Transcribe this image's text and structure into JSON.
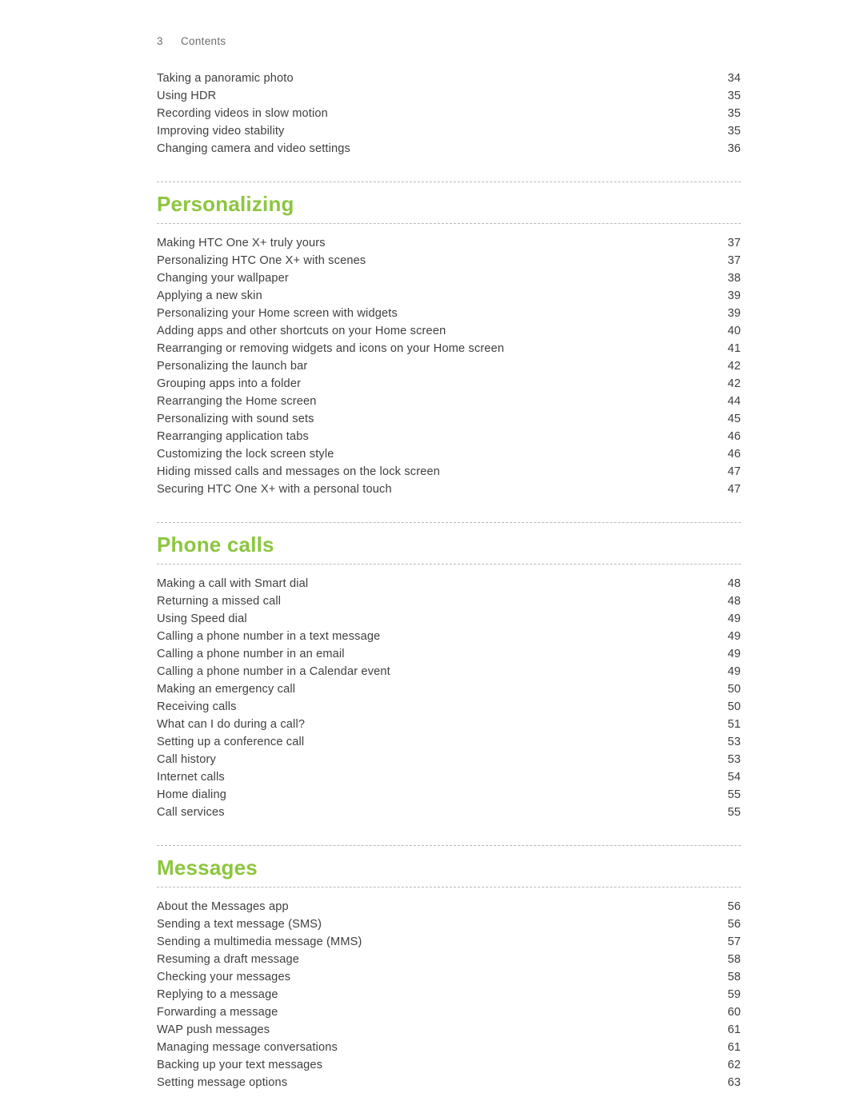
{
  "header": {
    "page_number": "3",
    "label": "Contents"
  },
  "top_entries": [
    {
      "title": "Taking a panoramic photo",
      "page": "34"
    },
    {
      "title": "Using HDR",
      "page": "35"
    },
    {
      "title": "Recording videos in slow motion",
      "page": "35"
    },
    {
      "title": "Improving video stability",
      "page": "35"
    },
    {
      "title": "Changing camera and video settings",
      "page": "36"
    }
  ],
  "sections": [
    {
      "title": "Personalizing",
      "entries": [
        {
          "title": "Making HTC One X+ truly yours",
          "page": "37"
        },
        {
          "title": "Personalizing HTC One X+ with scenes",
          "page": "37"
        },
        {
          "title": "Changing your wallpaper",
          "page": "38"
        },
        {
          "title": "Applying a new skin",
          "page": "39"
        },
        {
          "title": "Personalizing your Home screen with widgets",
          "page": "39"
        },
        {
          "title": "Adding apps and other shortcuts on your Home screen",
          "page": "40"
        },
        {
          "title": "Rearranging or removing widgets and icons on your Home screen",
          "page": "41"
        },
        {
          "title": "Personalizing the launch bar",
          "page": "42"
        },
        {
          "title": "Grouping apps into a folder",
          "page": "42"
        },
        {
          "title": "Rearranging the Home screen",
          "page": "44"
        },
        {
          "title": "Personalizing with sound sets",
          "page": "45"
        },
        {
          "title": "Rearranging application tabs",
          "page": "46"
        },
        {
          "title": "Customizing the lock screen style",
          "page": "46"
        },
        {
          "title": "Hiding missed calls and messages on the lock screen",
          "page": "47"
        },
        {
          "title": "Securing HTC One X+ with a personal touch",
          "page": "47"
        }
      ]
    },
    {
      "title": "Phone calls",
      "entries": [
        {
          "title": "Making a call with Smart dial",
          "page": "48"
        },
        {
          "title": "Returning a missed call",
          "page": "48"
        },
        {
          "title": "Using Speed dial",
          "page": "49"
        },
        {
          "title": "Calling a phone number in a text message",
          "page": "49"
        },
        {
          "title": "Calling a phone number in an email",
          "page": "49"
        },
        {
          "title": "Calling a phone number in a Calendar event",
          "page": "49"
        },
        {
          "title": "Making an emergency call",
          "page": "50"
        },
        {
          "title": "Receiving calls",
          "page": "50"
        },
        {
          "title": "What can I do during a call?",
          "page": "51"
        },
        {
          "title": "Setting up a conference call",
          "page": "53"
        },
        {
          "title": "Call history",
          "page": "53"
        },
        {
          "title": "Internet calls",
          "page": "54"
        },
        {
          "title": "Home dialing",
          "page": "55"
        },
        {
          "title": "Call services",
          "page": "55"
        }
      ]
    },
    {
      "title": "Messages",
      "entries": [
        {
          "title": "About the Messages app",
          "page": "56"
        },
        {
          "title": "Sending a text message (SMS)",
          "page": "56"
        },
        {
          "title": "Sending a multimedia message (MMS)",
          "page": "57"
        },
        {
          "title": "Resuming a draft message",
          "page": "58"
        },
        {
          "title": "Checking your messages",
          "page": "58"
        },
        {
          "title": "Replying to a message",
          "page": "59"
        },
        {
          "title": "Forwarding a message",
          "page": "60"
        },
        {
          "title": "WAP push messages",
          "page": "61"
        },
        {
          "title": "Managing message conversations",
          "page": "61"
        },
        {
          "title": "Backing up your text messages",
          "page": "62"
        },
        {
          "title": "Setting message options",
          "page": "63"
        }
      ]
    }
  ]
}
